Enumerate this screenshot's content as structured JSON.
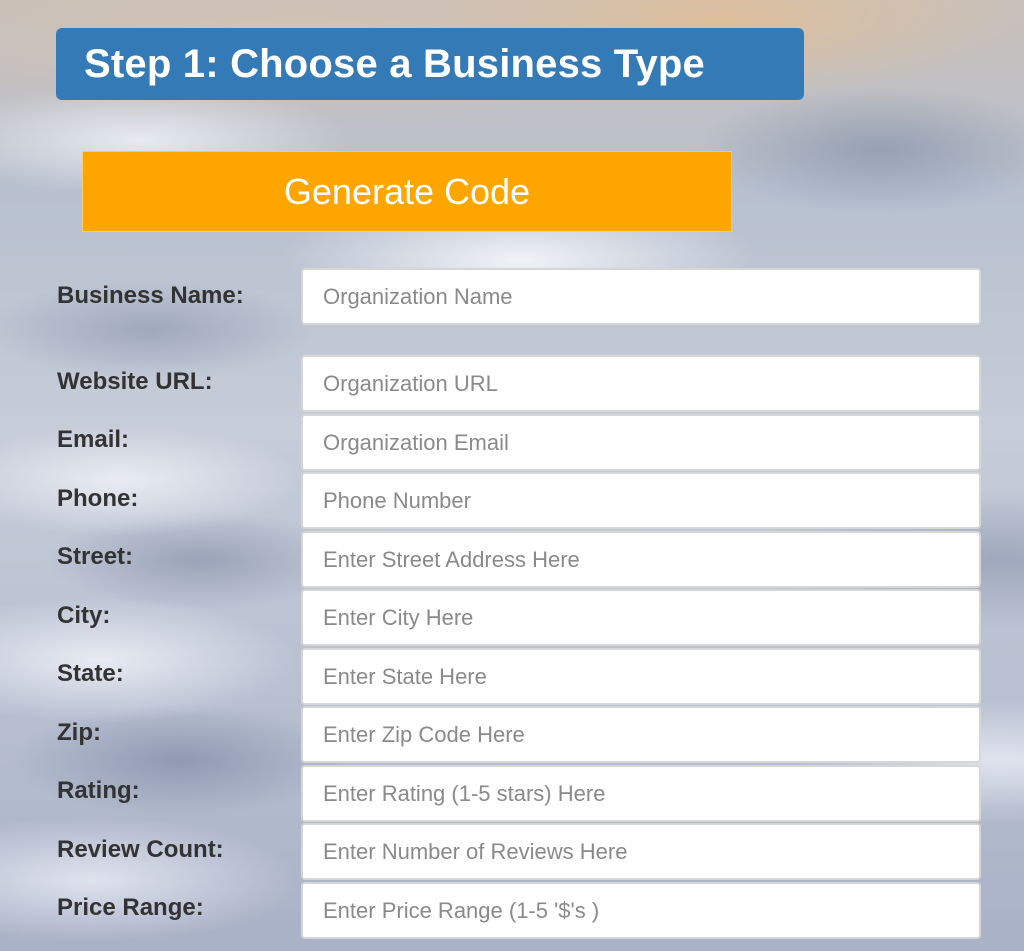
{
  "header": {
    "title": "Step 1: Choose a Business Type"
  },
  "actions": {
    "generate_label": "Generate Code"
  },
  "form": {
    "fields": [
      {
        "label": "Business Name:",
        "placeholder": "Organization Name",
        "value": ""
      },
      {
        "label": "Website URL:",
        "placeholder": "Organization URL",
        "value": ""
      },
      {
        "label": "Email:",
        "placeholder": "Organization Email",
        "value": ""
      },
      {
        "label": "Phone:",
        "placeholder": "Phone Number",
        "value": ""
      },
      {
        "label": "Street:",
        "placeholder": "Enter Street Address Here",
        "value": ""
      },
      {
        "label": "City:",
        "placeholder": "Enter City Here",
        "value": ""
      },
      {
        "label": "State:",
        "placeholder": "Enter State Here",
        "value": ""
      },
      {
        "label": "Zip:",
        "placeholder": "Enter Zip Code Here",
        "value": ""
      },
      {
        "label": "Rating:",
        "placeholder": "Enter Rating (1-5 stars) Here",
        "value": ""
      },
      {
        "label": "Review Count:",
        "placeholder": "Enter Number of Reviews Here",
        "value": ""
      },
      {
        "label": "Price Range:",
        "placeholder": "Enter Price Range (1-5 '$'s )",
        "value": ""
      }
    ]
  },
  "colors": {
    "title_bg": "#337ab7",
    "button_bg": "#ffa500",
    "label_text": "#333333"
  }
}
